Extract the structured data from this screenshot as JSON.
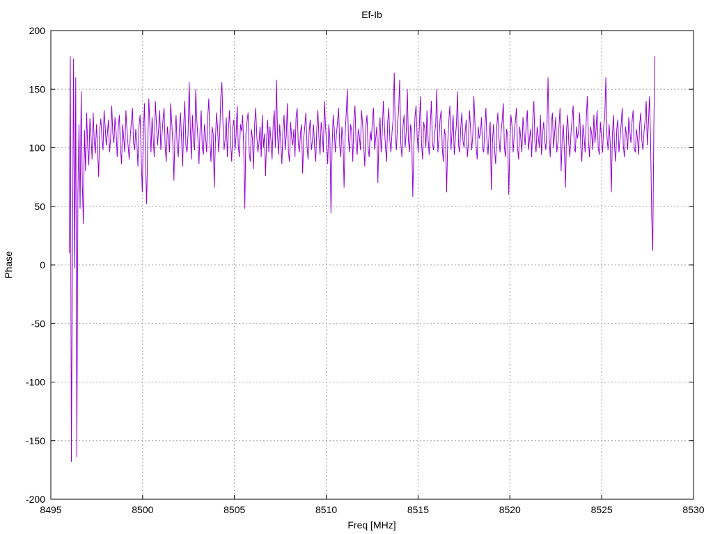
{
  "chart_data": {
    "type": "line",
    "title": "Ef-Ib",
    "xlabel": "Freq [MHz]",
    "ylabel": "Phase",
    "xlim": [
      8495,
      8530
    ],
    "ylim": [
      -200,
      200
    ],
    "xticks": [
      8495,
      8500,
      8505,
      8510,
      8515,
      8520,
      8525,
      8530
    ],
    "yticks": [
      -200,
      -150,
      -100,
      -50,
      0,
      50,
      100,
      150,
      200
    ],
    "grid": true,
    "grid_style": "dotted",
    "colors": {
      "series": "#9400d3",
      "grid": "#a0a0a0",
      "axes": "#000000"
    },
    "series": [
      {
        "x_start": 8496.0,
        "x_end": 8527.9,
        "values": [
          10,
          178,
          -168,
          5,
          176,
          -3,
          160,
          -164,
          60,
          120,
          48,
          148,
          70,
          35,
          115,
          80,
          130,
          100,
          85,
          125,
          110,
          90,
          130,
          105,
          95,
          120,
          100,
          75,
          115,
          125,
          108,
          98,
          132,
          118,
          102,
          112,
          124,
          96,
          108,
          136,
          112,
          104,
          126,
          114,
          92,
          118,
          128,
          100,
          86,
          120,
          108,
          96,
          132,
          114,
          102,
          90,
          110,
          122,
          134,
          104,
          98,
          116,
          106,
          84,
          118,
          128,
          92,
          62,
          112,
          138,
          88,
          52,
          102,
          142,
          118,
          96,
          126,
          108,
          92,
          140,
          120,
          102,
          116,
          132,
          98,
          110,
          124,
          134,
          100,
          88,
          118,
          108,
          96,
          138,
          122,
          104,
          72,
          112,
          128,
          100,
          92,
          116,
          130,
          108,
          84,
          120,
          140,
          102,
          96,
          112,
          156,
          118,
          90,
          128,
          104,
          98,
          150,
          124,
          108,
          86,
          116,
          132,
          100,
          94,
          120,
          110,
          96,
          126,
          142,
          106,
          88,
          118,
          112,
          66,
          104,
          130,
          118,
          96,
          112,
          144,
          156,
          120,
          98,
          108,
          126,
          92,
          116,
          132,
          104,
          88,
          118,
          124,
          98,
          110,
          136,
          102,
          92,
          120,
          114,
          128,
          100,
          48,
          112,
          122,
          130,
          96,
          88,
          116,
          108,
          82,
          120,
          134,
          110,
          96,
          104,
          118,
          92,
          128,
          100,
          112,
          76,
          108,
          124,
          96,
          118,
          106,
          90,
          120,
          132,
          100,
          158,
          112,
          94,
          120,
          104,
          86,
          116,
          128,
          98,
          110,
          138,
          96,
          88,
          122,
          108,
          102,
          116,
          92,
          126,
          134,
          104,
          96,
          112,
          120,
          78,
          108,
          118,
          130,
          102,
          90,
          114,
          124,
          98,
          106,
          120,
          100,
          88,
          116,
          132,
          108,
          94,
          122,
          112,
          96,
          140,
          118,
          104,
          86,
          120,
          108,
          44,
          100,
          128,
          116,
          96,
          112,
          122,
          134,
          102,
          92,
          118,
          108,
          66,
          112,
          130,
          150,
          108,
          96,
          120,
          114,
          88,
          124,
          136,
          104,
          94,
          116,
          110,
          98,
          132,
          120,
          102,
          84,
          118,
          128,
          100,
          92,
          114,
          106,
          124,
          134,
          98,
          108,
          118,
          70,
          110,
          126,
          96,
          112,
          140,
          118,
          100,
          88,
          122,
          134,
          106,
          96,
          114,
          124,
          164,
          110,
          98,
          120,
          132,
          158,
          104,
          92,
          118,
          128,
          100,
          114,
          150,
          106,
          96,
          120,
          112,
          58,
          102,
          126,
          136,
          110,
          96,
          118,
          144,
          104,
          90,
          122,
          116,
          100,
          132,
          108,
          94,
          118,
          140,
          104,
          98,
          112,
          120,
          150,
          96,
          108,
          124,
          132,
          100,
          88,
          116,
          110,
          62,
          104,
          122,
          136,
          98,
          114,
          128,
          94,
          108,
          120,
          148,
          102,
          96,
          118,
          130,
          106,
          100,
          114,
          124,
          92,
          104,
          132,
          116,
          98,
          110,
          144,
          120,
          102,
          90,
          118,
          108,
          112,
          126,
          100,
          96,
          116,
          134,
          106,
          94,
          112,
          122,
          64,
          104,
          120,
          98,
          86,
          118,
          130,
          108,
          96,
          114,
          124,
          138,
          100,
          92,
          116,
          110,
          60,
          104,
          128,
          118,
          96,
          112,
          122,
          134,
          100,
          90,
          118,
          108,
          96,
          126,
          114,
          102,
          120,
          132,
          98,
          108,
          116,
          92,
          124,
          140,
          104,
          96,
          118,
          110,
          100,
          128,
          94,
          112,
          122,
          106,
          98,
          118,
          160,
          108,
          92,
          120,
          130,
          100,
          112,
          126,
          96,
          104,
          118,
          134,
          80,
          108,
          120,
          98,
          66,
          116,
          128,
          104,
          92,
          112,
          124,
          136,
          100,
          96,
          118,
          108,
          114,
          130,
          102,
          88,
          120,
          110,
          96,
          124,
          144,
          106,
          92,
          118,
          112,
          98,
          128,
          104,
          116,
          132,
          100,
          94,
          122,
          108,
          96,
          118,
          126,
          160,
          110,
          98,
          120,
          104,
          62,
          112,
          128,
          100,
          88,
          116,
          124,
          96,
          108,
          120,
          134,
          102,
          92,
          118,
          110,
          98,
          126,
          114,
          104,
          122,
          132,
          100,
          96,
          116,
          108,
          94,
          120,
          130,
          106,
          98,
          114,
          124,
          140,
          102,
          120,
          144,
          108,
          42,
          12,
          120,
          178
        ]
      }
    ]
  }
}
